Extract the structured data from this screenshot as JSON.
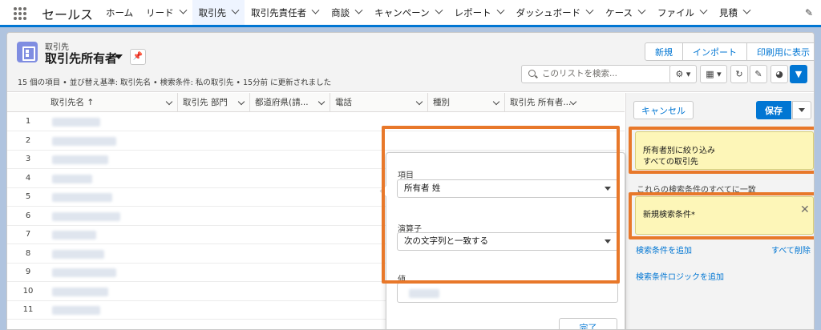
{
  "nav": {
    "app_name": "セールス",
    "items": [
      {
        "label": "ホーム",
        "has_menu": false
      },
      {
        "label": "リード",
        "has_menu": true
      },
      {
        "label": "取引先",
        "has_menu": true
      },
      {
        "label": "取引先責任者",
        "has_menu": true
      },
      {
        "label": "商談",
        "has_menu": true
      },
      {
        "label": "キャンペーン",
        "has_menu": true
      },
      {
        "label": "レポート",
        "has_menu": true
      },
      {
        "label": "ダッシュボード",
        "has_menu": true
      },
      {
        "label": "ケース",
        "has_menu": true
      },
      {
        "label": "ファイル",
        "has_menu": true
      },
      {
        "label": "見積",
        "has_menu": true
      }
    ],
    "active_index": 2,
    "edit_icon": "pencil-icon"
  },
  "header": {
    "object_label": "取引先",
    "list_view_name": "取引先所有者",
    "status": "15 個の項目 • 並び替え基準: 取引先名 • 検索条件: 私の取引先 • 15分前 に更新されました",
    "buttons": {
      "new": "新規",
      "import": "インポート",
      "print": "印刷用に表示"
    },
    "search_placeholder": "このリストを検索...",
    "tools": [
      "gear-icon",
      "table-icon",
      "refresh-icon",
      "pencil-icon",
      "chart-icon",
      "filter-icon"
    ]
  },
  "table": {
    "columns": [
      "取引先名 ↑",
      "取引先 部門",
      "都道府県(請...",
      "電話",
      "種別",
      "取引先 所有者..."
    ],
    "rows": [
      "1",
      "2",
      "3",
      "4",
      "5",
      "6",
      "7",
      "8",
      "9",
      "10",
      "11"
    ]
  },
  "popover": {
    "field_label": "項目",
    "field_value": "所有者 姓",
    "operator_label": "演算子",
    "operator_value": "次の文字列と一致する",
    "value_label": "値",
    "done": "完了"
  },
  "filters": {
    "cancel": "キャンセル",
    "save": "保存",
    "owner_title": "所有者別に絞り込み",
    "owner_value": "すべての取引先",
    "match_label": "これらの検索条件のすべてに一致",
    "new_condition": "新規検索条件*",
    "add_filter": "検索条件を追加",
    "remove_all": "すべて削除",
    "add_logic": "検索条件ロジックを追加"
  },
  "colors": {
    "brand": "#0176d3",
    "highlight": "#e8782a",
    "filter_card": "#fdf6b8"
  }
}
